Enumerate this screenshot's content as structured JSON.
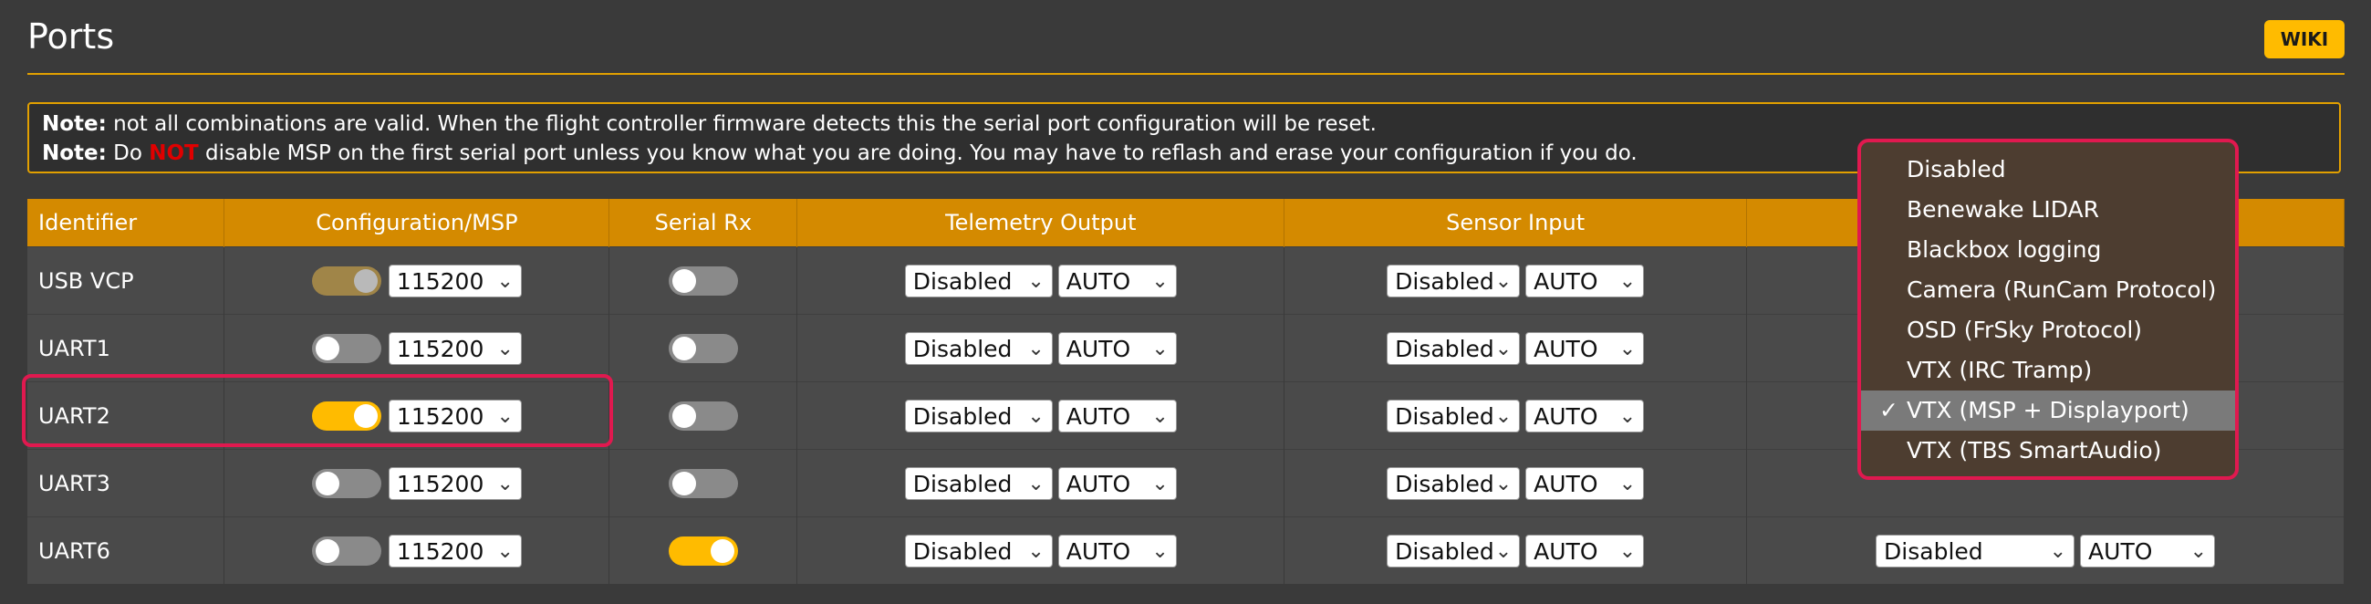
{
  "header": {
    "title": "Ports",
    "wiki_label": "WIKI"
  },
  "note": {
    "line1_prefix": "Note:",
    "line1_text": " not all combinations are valid. When the flight controller firmware detects this the serial port configuration will be reset.",
    "line2_prefix": "Note:",
    "line2_text_a": " Do ",
    "line2_not": "NOT",
    "line2_text_b": " disable MSP on the first serial port unless you know what you are doing. You may have to reflash and erase your configuration if you do."
  },
  "table": {
    "columns": [
      "Identifier",
      "Configuration/MSP",
      "Serial Rx",
      "Telemetry Output",
      "Sensor Input",
      ""
    ],
    "rows": [
      {
        "id": "USB VCP",
        "msp": "dim",
        "baud": "115200",
        "rx": "off",
        "telemetry": "Disabled",
        "telemetry_baud": "AUTO",
        "sensor": "Disabled",
        "sensor_baud": "AUTO",
        "peripheral": "",
        "peripheral_baud": ""
      },
      {
        "id": "UART1",
        "msp": "off",
        "baud": "115200",
        "rx": "off",
        "telemetry": "Disabled",
        "telemetry_baud": "AUTO",
        "sensor": "Disabled",
        "sensor_baud": "AUTO",
        "peripheral": "",
        "peripheral_baud": ""
      },
      {
        "id": "UART2",
        "msp": "on",
        "baud": "115200",
        "rx": "off",
        "telemetry": "Disabled",
        "telemetry_baud": "AUTO",
        "sensor": "Disabled",
        "sensor_baud": "AUTO",
        "peripheral": "",
        "peripheral_baud": ""
      },
      {
        "id": "UART3",
        "msp": "off",
        "baud": "115200",
        "rx": "off",
        "telemetry": "Disabled",
        "telemetry_baud": "AUTO",
        "sensor": "Disabled",
        "sensor_baud": "AUTO",
        "peripheral": "",
        "peripheral_baud": ""
      },
      {
        "id": "UART6",
        "msp": "off",
        "baud": "115200",
        "rx": "on",
        "telemetry": "Disabled",
        "telemetry_baud": "AUTO",
        "sensor": "Disabled",
        "sensor_baud": "AUTO",
        "peripheral": "Disabled",
        "peripheral_baud": "AUTO"
      }
    ]
  },
  "dropdown": {
    "items": [
      "Disabled",
      "Benewake LIDAR",
      "Blackbox logging",
      "Camera (RunCam Protocol)",
      "OSD (FrSky Protocol)",
      "VTX (IRC Tramp)",
      "VTX (MSP + Displayport)",
      "VTX (TBS SmartAudio)"
    ],
    "selected": "VTX (MSP + Displayport)",
    "check_glyph": "✓"
  },
  "icons": {
    "chevron": "chevron-down-icon"
  },
  "colors": {
    "accent": "#d48a00",
    "wiki": "#ffbb00",
    "highlight": "#e0194f",
    "warning": "#e00000"
  }
}
